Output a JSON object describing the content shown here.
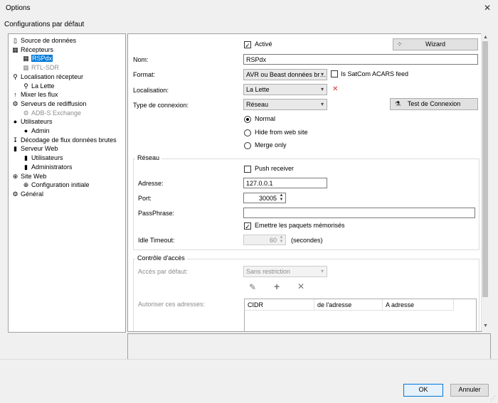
{
  "window": {
    "title": "Options",
    "subtitle": "Configurations par défaut"
  },
  "tree": [
    {
      "label": "Source de données",
      "icon": "document-icon",
      "glyph": "▯",
      "indent": 0,
      "state": "normal"
    },
    {
      "label": "Récepteurs",
      "icon": "radio-icon",
      "glyph": "▦",
      "indent": 0,
      "state": "normal"
    },
    {
      "label": "RSPdx",
      "icon": "radio-icon",
      "glyph": "▦",
      "indent": 1,
      "state": "selected"
    },
    {
      "label": "RTL-SDR",
      "icon": "radio-icon",
      "glyph": "▦",
      "indent": 1,
      "state": "disabled"
    },
    {
      "label": "Localisation récepteur",
      "icon": "location-pin-icon",
      "glyph": "⚲",
      "indent": 0,
      "state": "normal"
    },
    {
      "label": "La Lette",
      "icon": "location-pin-icon",
      "glyph": "⚲",
      "indent": 1,
      "state": "normal"
    },
    {
      "label": "Mixer les flux",
      "icon": "merge-arrow-icon",
      "glyph": "↑",
      "indent": 0,
      "state": "normal"
    },
    {
      "label": "Serveurs de rediffusion",
      "icon": "gear-network-icon",
      "glyph": "⚙",
      "indent": 0,
      "state": "normal"
    },
    {
      "label": "ADB-S Exchange",
      "icon": "gear-network-icon",
      "glyph": "⚙",
      "indent": 1,
      "state": "disabled"
    },
    {
      "label": "Utilisateurs",
      "icon": "user-icon",
      "glyph": "●",
      "indent": 0,
      "state": "normal"
    },
    {
      "label": "Admin",
      "icon": "user-icon",
      "glyph": "●",
      "indent": 1,
      "state": "normal"
    },
    {
      "label": "Décodage de flux données brutes",
      "icon": "decode-icon",
      "glyph": "↧",
      "indent": 0,
      "state": "normal"
    },
    {
      "label": "Serveur Web",
      "icon": "server-icon",
      "glyph": "▮",
      "indent": 0,
      "state": "normal"
    },
    {
      "label": "Utilisateurs",
      "icon": "server-icon",
      "glyph": "▮",
      "indent": 1,
      "state": "normal"
    },
    {
      "label": "Administrators",
      "icon": "server-icon",
      "glyph": "▮",
      "indent": 1,
      "state": "normal"
    },
    {
      "label": "Site Web",
      "icon": "globe-icon",
      "glyph": "⊕",
      "indent": 0,
      "state": "normal"
    },
    {
      "label": "Configuration initiale",
      "icon": "globe-icon",
      "glyph": "⊕",
      "indent": 1,
      "state": "normal"
    },
    {
      "label": "Général",
      "icon": "gear-icon",
      "glyph": "⚙",
      "indent": 0,
      "state": "normal"
    }
  ],
  "form": {
    "active_label": "Activé",
    "active_checked": true,
    "wizard_label": "Wizard",
    "name_label": "Nom:",
    "name_value": "RSPdx",
    "format_label": "Format:",
    "format_value": "AVR ou Beast données br…",
    "satcom_label": "Is SatCom ACARS feed",
    "satcom_checked": false,
    "location_label": "Localisation:",
    "location_value": "La Lette",
    "conn_type_label": "Type de connexion:",
    "conn_type_value": "Réseau",
    "test_label": "Test de Connexion",
    "radio_normal": "Normal",
    "radio_hide": "Hide from web site",
    "radio_merge": "Merge only",
    "radio_selected": "Normal"
  },
  "network": {
    "title": "Réseau",
    "push_label": "Push receiver",
    "push_checked": false,
    "address_label": "Adresse:",
    "address_value": "127.0.0.1",
    "port_label": "Port:",
    "port_value": "30005",
    "passphrase_label": "PassPhrase:",
    "passphrase_value": "",
    "emit_label": "Emettre les paquets mémorisés",
    "emit_checked": true,
    "idle_label": "Idle Timeout:",
    "idle_value": "60",
    "idle_unit": "(secondes)"
  },
  "access": {
    "title": "Contrôle d'accès",
    "default_label": "Accès par défaut:",
    "default_value": "Sans restriction",
    "allow_label": "Autoriser ces adresses:",
    "columns": [
      "CIDR",
      "de l'adresse",
      "A adresse"
    ]
  },
  "buttons": {
    "ok": "OK",
    "cancel": "Annuler"
  },
  "colors": {
    "selection": "#0078d7",
    "accent_border": "#0078d7",
    "remove_x": "#d13438"
  }
}
